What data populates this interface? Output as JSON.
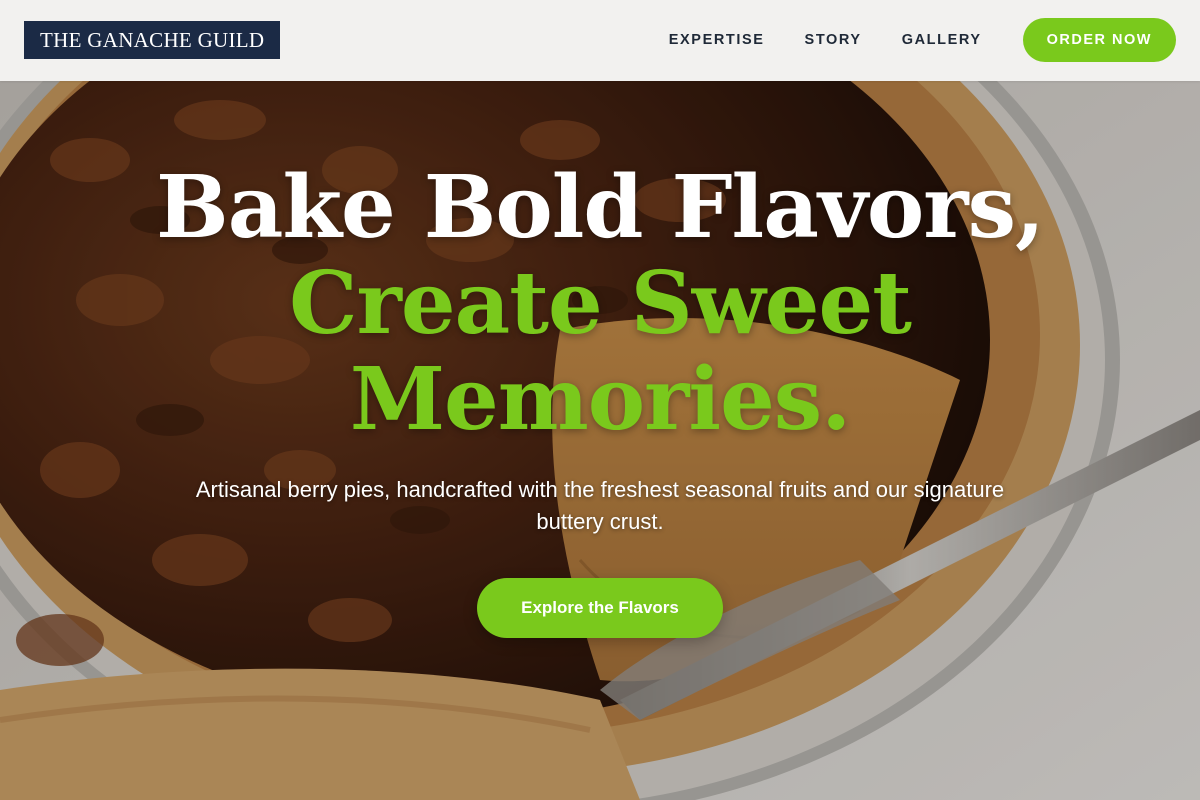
{
  "header": {
    "logo": "THE GANACHE GUILD",
    "nav": [
      {
        "label": "EXPERTISE"
      },
      {
        "label": "STORY"
      },
      {
        "label": "GALLERY"
      }
    ],
    "cta_label": "ORDER NOW"
  },
  "hero": {
    "title_line1": "Bake Bold Flavors,",
    "title_line2": "Create Sweet",
    "title_line3": "Memories.",
    "subtitle": "Artisanal berry pies, handcrafted with the freshest seasonal fruits and our signature buttery crust.",
    "cta_label": "Explore the Flavors",
    "background_image": "pecan-pie-photo"
  },
  "colors": {
    "accent_green": "#7ac91c",
    "logo_bg": "#1b2a45",
    "nav_text": "#1f2937",
    "header_bg": "#f2f1ef"
  }
}
